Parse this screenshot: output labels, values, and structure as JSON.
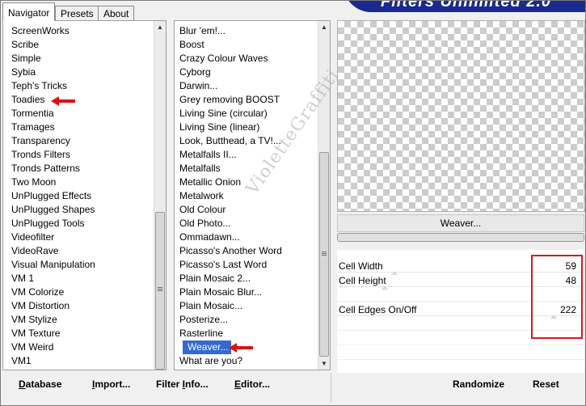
{
  "tabs": [
    {
      "label": "Navigator",
      "active": true
    },
    {
      "label": "Presets",
      "active": false
    },
    {
      "label": "About",
      "active": false
    }
  ],
  "banner": {
    "title": "Filters Unlimited 2.0",
    "color": "#1a2a8f"
  },
  "categories": {
    "items": [
      "ScreenWorks",
      "Scribe",
      "Simple",
      "Sybia",
      "Teph's Tricks",
      "Toadies",
      "Tormentia",
      "Tramages",
      "Transparency",
      "Tronds Filters",
      "Tronds Patterns",
      "Two Moon",
      "UnPlugged Effects",
      "UnPlugged Shapes",
      "UnPlugged Tools",
      "Videofilter",
      "VideoRave",
      "Visual Manipulation",
      "VM 1",
      "VM Colorize",
      "VM Distortion",
      "VM Stylize",
      "VM Texture",
      "VM Weird",
      "VM1"
    ],
    "highlighted": "Toadies"
  },
  "filters": {
    "items": [
      "Blur 'em!...",
      "Boost",
      "Crazy Colour Waves",
      "Cyborg",
      "Darwin...",
      "Grey removing BOOST",
      "Living Sine (circular)",
      "Living Sine (linear)",
      "Look, Butthead, a TV!...",
      "Metalfalls II...",
      "Metalfalls",
      "Metallic Onion",
      "Metalwork",
      "Old Colour",
      "Old Photo...",
      "Ommadawn...",
      "Picasso's Another Word",
      "Picasso's Last Word",
      "Plain Mosaic 2...",
      "Plain Mosaic Blur...",
      "Plain Mosaic...",
      "Posterize...",
      "Rasterline",
      "Weaver...",
      "What are you?"
    ],
    "selected": "Weaver..."
  },
  "preview": {
    "filter_name": "Weaver..."
  },
  "params": [
    {
      "label": "Cell Width",
      "value": "59",
      "slider_fraction": 0.23
    },
    {
      "label": "Cell Height",
      "value": "48",
      "slider_fraction": 0.19
    },
    {
      "label": "Cell Edges On/Off",
      "value": "222",
      "slider_fraction": 0.87
    }
  ],
  "bottom_bar": {
    "database": {
      "accel": "D",
      "rest": "atabase"
    },
    "import": {
      "accel": "I",
      "rest": "mport..."
    },
    "filter_info": {
      "prefix": "Filter ",
      "accel": "I",
      "rest": "nfo..."
    },
    "editor": {
      "accel": "E",
      "rest": "ditor..."
    },
    "randomize": "Randomize",
    "reset": "Reset"
  },
  "watermark": "VioletteGraffiti",
  "colors": {
    "selection": "#3469d4",
    "annotation_red": "#e01010",
    "highlight_box": "#d41c1c"
  }
}
